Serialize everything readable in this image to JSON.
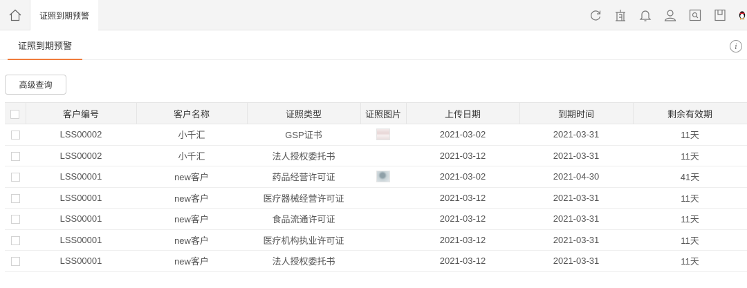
{
  "topbar": {
    "active_tab": "证照到期预警",
    "icons": [
      "home-icon",
      "refresh-icon",
      "building-icon",
      "bell-icon",
      "user-icon",
      "search-window-icon",
      "bookmark-icon",
      "penguin-icon"
    ]
  },
  "subnav": {
    "tab": "证照到期预警",
    "accent_color": "#f07c3c"
  },
  "toolbar": {
    "advanced_search": "高级查询"
  },
  "table": {
    "columns": [
      "客户编号",
      "客户名称",
      "证照类型",
      "证照图片",
      "上传日期",
      "到期时间",
      "剩余有效期"
    ],
    "rows": [
      {
        "code": "LSS00002",
        "name": "小千汇",
        "type": "GSP证书",
        "image": "pink",
        "upload": "2021-03-02",
        "expire": "2021-03-31",
        "remain": "11天"
      },
      {
        "code": "LSS00002",
        "name": "小千汇",
        "type": "法人授权委托书",
        "image": "",
        "upload": "2021-03-12",
        "expire": "2021-03-31",
        "remain": "11天"
      },
      {
        "code": "LSS00001",
        "name": "new客户",
        "type": "药品经营许可证",
        "image": "blue",
        "upload": "2021-03-02",
        "expire": "2021-04-30",
        "remain": "41天"
      },
      {
        "code": "LSS00001",
        "name": "new客户",
        "type": "医疗器械经营许可证",
        "image": "",
        "upload": "2021-03-12",
        "expire": "2021-03-31",
        "remain": "11天"
      },
      {
        "code": "LSS00001",
        "name": "new客户",
        "type": "食品流通许可证",
        "image": "",
        "upload": "2021-03-12",
        "expire": "2021-03-31",
        "remain": "11天"
      },
      {
        "code": "LSS00001",
        "name": "new客户",
        "type": "医疗机构执业许可证",
        "image": "",
        "upload": "2021-03-12",
        "expire": "2021-03-31",
        "remain": "11天"
      },
      {
        "code": "LSS00001",
        "name": "new客户",
        "type": "法人授权委托书",
        "image": "",
        "upload": "2021-03-12",
        "expire": "2021-03-31",
        "remain": "11天"
      }
    ]
  }
}
